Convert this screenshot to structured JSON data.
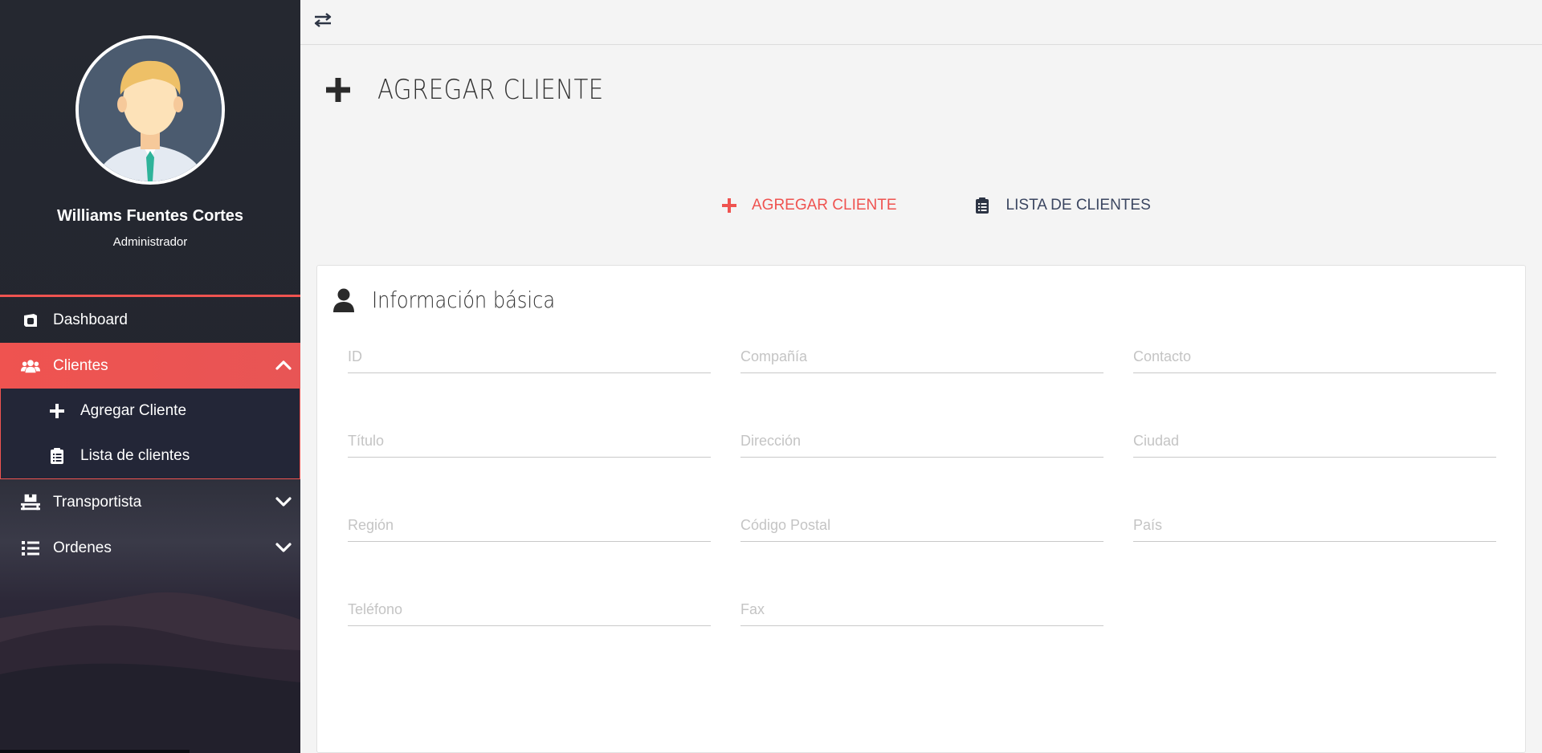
{
  "user": {
    "name": "Williams Fuentes Cortes",
    "role": "Administrador"
  },
  "nav": {
    "dashboard": "Dashboard",
    "clientes": "Clientes",
    "agregar_cliente": "Agregar Cliente",
    "lista_clientes": "Lista de clientes",
    "transportista": "Transportista",
    "ordenes": "Ordenes"
  },
  "page": {
    "title": "AGREGAR CLIENTE"
  },
  "tabs": {
    "agregar": "AGREGAR CLIENTE",
    "lista": "LISTA DE CLIENTES"
  },
  "card": {
    "title": "Información básica"
  },
  "form": {
    "id": "ID",
    "compania": "Compañía",
    "contacto": "Contacto",
    "titulo": "Título",
    "direccion": "Dirección",
    "ciudad": "Ciudad",
    "region": "Región",
    "codigo_postal": "Código Postal",
    "pais": "País",
    "telefono": "Teléfono",
    "fax": "Fax"
  },
  "colors": {
    "accent": "#ef5350",
    "sidebar": "#252830",
    "tab_inactive": "#3a4560"
  },
  "icons": {
    "toggle": "exchange-icon",
    "page": "plus-icon",
    "card": "user-icon",
    "dashboard": "dashboard-icon",
    "clientes": "users-icon",
    "agregar": "plus-icon",
    "lista": "clipboard-list-icon",
    "transportista": "dolly-icon",
    "ordenes": "list-icon"
  }
}
